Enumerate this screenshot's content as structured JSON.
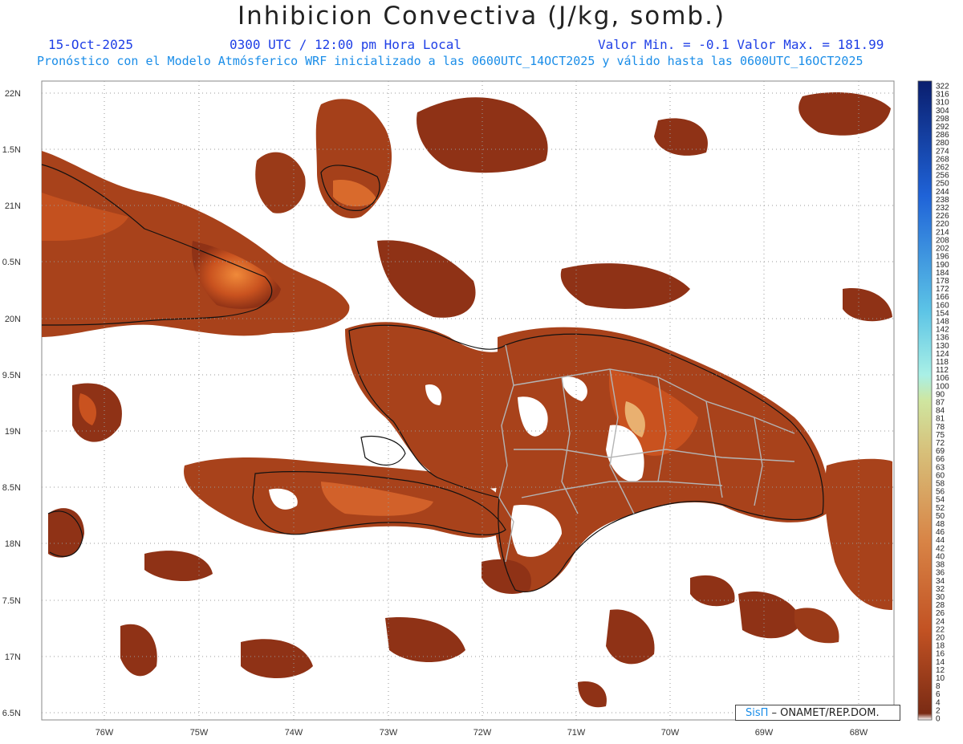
{
  "header": {
    "title": "Inhibicion Convectiva (J/kg, somb.)",
    "date": "15-Oct-2025",
    "time": "0300 UTC / 12:00 pm Hora Local",
    "minmax": "Valor Min. = -0.1  Valor Max. = 181.99",
    "model_line": "Pronóstico con el Modelo Atmósferico WRF inicializado a las 0600UTC_14OCT2025 y válido hasta las  0600UTC_16OCT2025"
  },
  "axes": {
    "lat_labels": [
      "22N",
      "1.5N",
      "21N",
      "0.5N",
      "20N",
      "9.5N",
      "19N",
      "8.5N",
      "18N",
      "7.5N",
      "17N",
      "6.5N"
    ],
    "lon_labels": [
      "76W",
      "75W",
      "74W",
      "73W",
      "72W",
      "71W",
      "70W",
      "69W",
      "68W"
    ]
  },
  "colorbar": {
    "labels": [
      "322",
      "316",
      "310",
      "304",
      "298",
      "292",
      "286",
      "280",
      "274",
      "268",
      "262",
      "256",
      "250",
      "244",
      "238",
      "232",
      "226",
      "220",
      "214",
      "208",
      "202",
      "196",
      "190",
      "184",
      "178",
      "172",
      "166",
      "160",
      "154",
      "148",
      "142",
      "136",
      "130",
      "124",
      "118",
      "112",
      "106",
      "100",
      "90",
      "87",
      "84",
      "81",
      "78",
      "75",
      "72",
      "69",
      "66",
      "63",
      "60",
      "58",
      "56",
      "54",
      "52",
      "50",
      "48",
      "46",
      "44",
      "42",
      "40",
      "38",
      "36",
      "34",
      "32",
      "30",
      "28",
      "26",
      "24",
      "22",
      "20",
      "18",
      "16",
      "14",
      "12",
      "10",
      "8",
      "6",
      "4",
      "2",
      "0"
    ]
  },
  "credit": {
    "brand": "SisΠ",
    "text": " – ONAMET/REP.DOM."
  },
  "colors": {
    "field_dark": "#7a2b14",
    "field_mid": "#b8461c",
    "field_hot": "#e06a2a",
    "coast": "#111111",
    "province": "#b4b4b4",
    "cbar_blue": "#0a2a8c",
    "cbar_cyan": "#7fe6dc",
    "cbar_red": "#7a2b14"
  }
}
